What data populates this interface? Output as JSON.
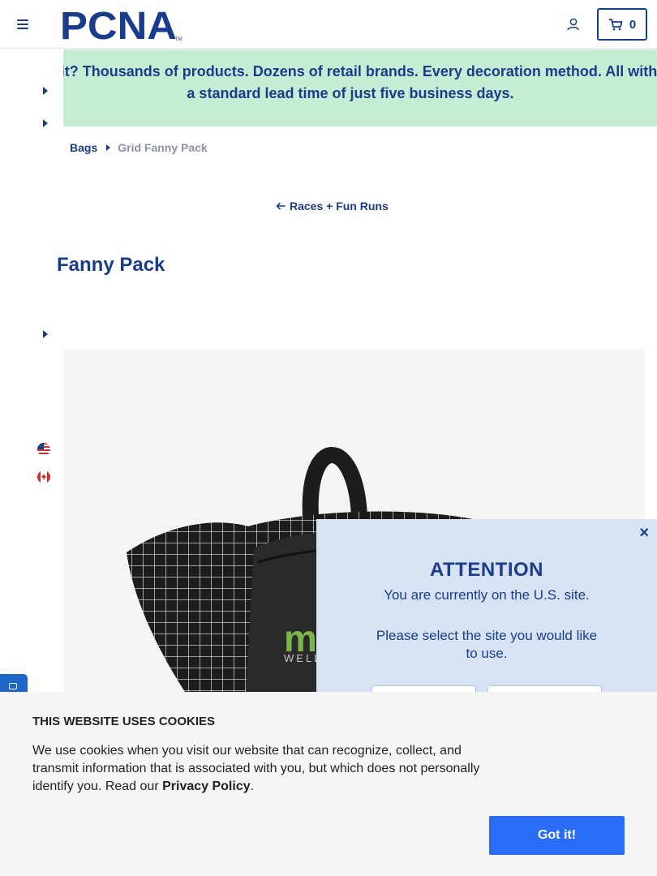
{
  "header": {
    "logo_text": "PCNA",
    "logo_tm": "TM",
    "cart_count": "0",
    "icons": {
      "menu": "hamburger-icon",
      "account": "user-icon",
      "cart": "shopping-cart-icon"
    }
  },
  "banner": {
    "text": "Vait? Thousands of products. Dozens of retail brands. Every decoration method. All with a standard lead time of just five business days."
  },
  "breadcrumb": {
    "parent": "Bags",
    "current": "Grid Fanny Pack"
  },
  "back_link": {
    "label": "Races + Fun Runs",
    "icon": "arrow-left-icon"
  },
  "product": {
    "title": "Fanny Pack",
    "image_brand_text": "m",
    "image_brand_subtext": "WELL"
  },
  "side_panel": {
    "flags": [
      "us-flag-icon",
      "canada-flag-icon"
    ]
  },
  "attention_modal": {
    "title": "ATTENTION",
    "message": "You are currently on the U.S. site.",
    "prompt": "Please select the site you would like to use.",
    "close_label": "×",
    "buttons": [
      "",
      ""
    ]
  },
  "cookie_banner": {
    "title": "THIS WEBSITE USES COOKIES",
    "body": "We use cookies when you visit our website that can recognize, collect, and transmit information that is associated with you, but which does not personally identify you. Read our ",
    "policy_link": "Privacy Policy",
    "period": ".",
    "accept_label": "Got it!"
  },
  "colors": {
    "brand_navy": "#1a3c8c",
    "banner_green": "#c6ecd4",
    "modal_bg": "#d7e2f3",
    "cookie_button": "#2b6cf6"
  }
}
